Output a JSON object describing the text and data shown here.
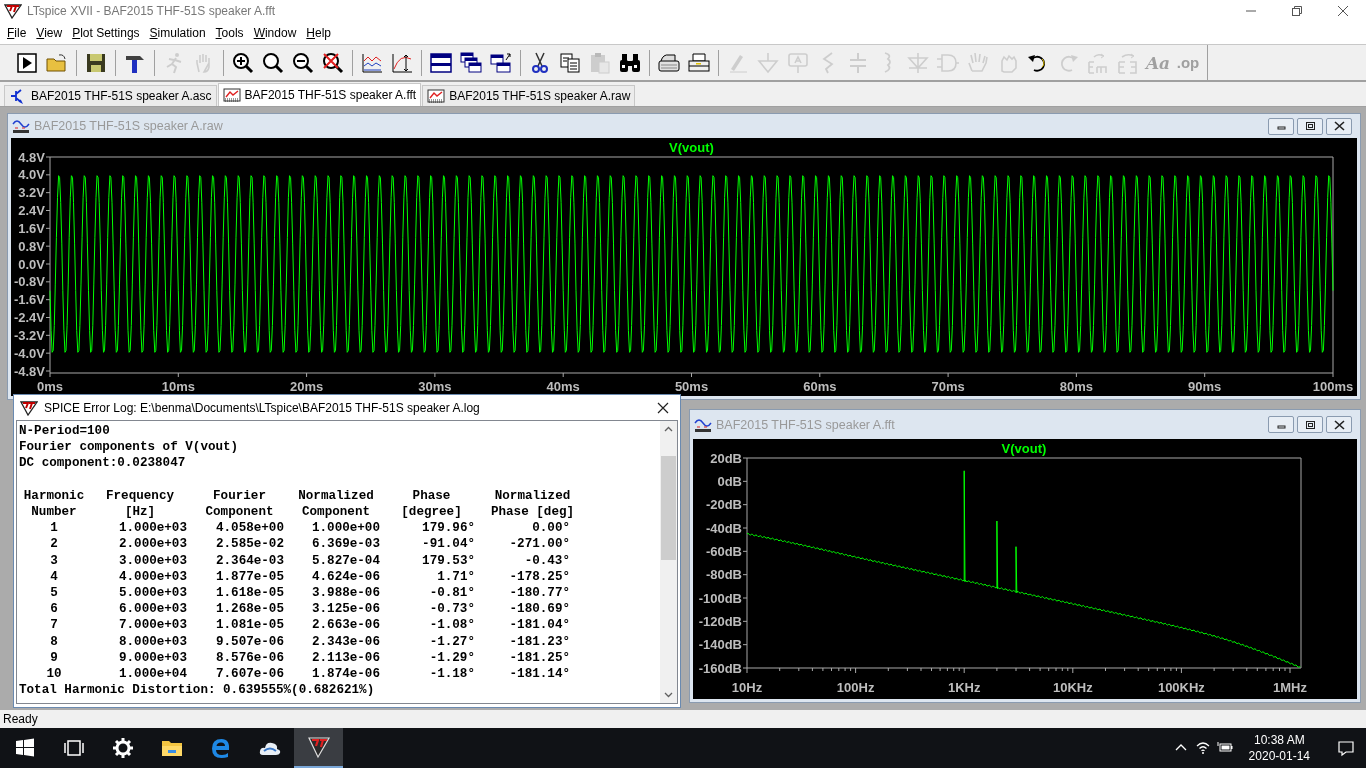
{
  "window": {
    "title": "LTspice XVII - BAF2015 THF-51S speaker A.fft"
  },
  "menu": [
    "File",
    "View",
    "Plot Settings",
    "Simulation",
    "Tools",
    "Window",
    "Help"
  ],
  "toolbar": [
    {
      "kind": "run",
      "disabled": false
    },
    {
      "kind": "open",
      "disabled": false
    },
    {
      "kind": "separator"
    },
    {
      "kind": "save",
      "disabled": false
    },
    {
      "kind": "separator"
    },
    {
      "kind": "hammer",
      "disabled": false
    },
    {
      "kind": "separator"
    },
    {
      "kind": "runner",
      "disabled": true
    },
    {
      "kind": "hand",
      "disabled": true
    },
    {
      "kind": "separator"
    },
    {
      "kind": "zoom-in",
      "disabled": false
    },
    {
      "kind": "zoom",
      "disabled": false
    },
    {
      "kind": "zoom-out",
      "disabled": false
    },
    {
      "kind": "zoom-cancel",
      "disabled": false
    },
    {
      "kind": "separator"
    },
    {
      "kind": "autorange",
      "disabled": false
    },
    {
      "kind": "marker",
      "disabled": false
    },
    {
      "kind": "separator"
    },
    {
      "kind": "tile",
      "disabled": false
    },
    {
      "kind": "cascade",
      "disabled": false
    },
    {
      "kind": "arrange",
      "disabled": false
    },
    {
      "kind": "separator"
    },
    {
      "kind": "cut",
      "disabled": false
    },
    {
      "kind": "copy",
      "disabled": false
    },
    {
      "kind": "paste",
      "disabled": true
    },
    {
      "kind": "find",
      "disabled": false
    },
    {
      "kind": "separator"
    },
    {
      "kind": "preview",
      "disabled": false
    },
    {
      "kind": "print",
      "disabled": false
    },
    {
      "kind": "separator"
    },
    {
      "kind": "pencil",
      "disabled": true
    },
    {
      "kind": "ground",
      "disabled": true
    },
    {
      "kind": "flag",
      "disabled": true
    },
    {
      "kind": "resistor",
      "disabled": true
    },
    {
      "kind": "capacitor",
      "disabled": true
    },
    {
      "kind": "inductor",
      "disabled": true
    },
    {
      "kind": "diode",
      "disabled": true
    },
    {
      "kind": "gate",
      "disabled": true
    },
    {
      "kind": "drag",
      "disabled": true
    },
    {
      "kind": "move",
      "disabled": true
    },
    {
      "kind": "undo",
      "disabled": false
    },
    {
      "kind": "redo",
      "disabled": true
    },
    {
      "kind": "rotate",
      "disabled": true
    },
    {
      "kind": "mirror",
      "disabled": true
    },
    {
      "kind": "font",
      "label": "Aa",
      "disabled": true
    },
    {
      "kind": "directive",
      "label": ".op",
      "disabled": true
    }
  ],
  "tabs": [
    {
      "label": "BAF2015 THF-51S speaker A.asc",
      "kind": "schematic",
      "selected": false
    },
    {
      "label": "BAF2015 THF-51S speaker A.fft",
      "kind": "plot",
      "selected": true
    },
    {
      "label": "BAF2015 THF-51S speaker A.raw",
      "kind": "plot",
      "selected": false
    }
  ],
  "waveform_window": {
    "title": "BAF2015 THF-51S speaker A.raw",
    "trace": "V(vout)",
    "y_ticks": [
      "4.8V",
      "4.0V",
      "3.2V",
      "2.4V",
      "1.6V",
      "0.8V",
      "0.0V",
      "-0.8V",
      "-1.6V",
      "-2.4V",
      "-3.2V",
      "-4.0V",
      "-4.8V"
    ],
    "x_ticks": [
      "0ms",
      "10ms",
      "20ms",
      "30ms",
      "40ms",
      "50ms",
      "60ms",
      "70ms",
      "80ms",
      "90ms",
      "100ms"
    ]
  },
  "log_window": {
    "title": "SPICE Error Log: E:\\benma\\Documents\\LTspice\\BAF2015 THF-51S speaker A.log",
    "lines": [
      "N-Period=100",
      "Fourier components of V(vout)",
      "DC component:0.0238047"
    ],
    "columns": [
      "Harmonic\nNumber",
      "Frequency\n[Hz]",
      "Fourier\nComponent",
      "Normalized\nComponent",
      "Phase\n[degree]",
      "Normalized\nPhase [deg]"
    ],
    "rows": [
      [
        "1",
        "1.000e+03",
        "4.058e+00",
        "1.000e+00",
        "179.96°",
        "0.00°"
      ],
      [
        "2",
        "2.000e+03",
        "2.585e-02",
        "6.369e-03",
        "-91.04°",
        "-271.00°"
      ],
      [
        "3",
        "3.000e+03",
        "2.364e-03",
        "5.827e-04",
        "179.53°",
        "-0.43°"
      ],
      [
        "4",
        "4.000e+03",
        "1.877e-05",
        "4.624e-06",
        "1.71°",
        "-178.25°"
      ],
      [
        "5",
        "5.000e+03",
        "1.618e-05",
        "3.988e-06",
        "-0.81°",
        "-180.77°"
      ],
      [
        "6",
        "6.000e+03",
        "1.268e-05",
        "3.125e-06",
        "-0.73°",
        "-180.69°"
      ],
      [
        "7",
        "7.000e+03",
        "1.081e-05",
        "2.663e-06",
        "-1.08°",
        "-181.04°"
      ],
      [
        "8",
        "8.000e+03",
        "9.507e-06",
        "2.343e-06",
        "-1.27°",
        "-181.23°"
      ],
      [
        "9",
        "9.000e+03",
        "8.576e-06",
        "2.113e-06",
        "-1.29°",
        "-181.25°"
      ],
      [
        "10",
        "1.000e+04",
        "7.607e-06",
        "1.874e-06",
        "-1.18°",
        "-181.14°"
      ]
    ],
    "footer": "Total Harmonic Distortion: 0.639555%(0.682621%)"
  },
  "fft_window": {
    "title": "BAF2015 THF-51S speaker A.fft",
    "trace": "V(vout)",
    "y_ticks": [
      "20dB",
      "0dB",
      "-20dB",
      "-40dB",
      "-60dB",
      "-80dB",
      "-100dB",
      "-120dB",
      "-140dB",
      "-160dB"
    ],
    "x_ticks": [
      "10Hz",
      "100Hz",
      "1KHz",
      "10KHz",
      "100KHz",
      "1MHz"
    ]
  },
  "status_bar": "Ready",
  "taskbar": {
    "apps": [
      {
        "kind": "start",
        "selected": false
      },
      {
        "kind": "task-view",
        "selected": false
      },
      {
        "kind": "settings",
        "selected": false
      },
      {
        "kind": "folder",
        "selected": false
      },
      {
        "kind": "browser",
        "selected": false
      },
      {
        "kind": "cloud",
        "selected": false
      },
      {
        "kind": "ltspice",
        "selected": true
      }
    ],
    "clock": {
      "time": "10:38 AM",
      "date": "2020-01-14"
    }
  }
}
